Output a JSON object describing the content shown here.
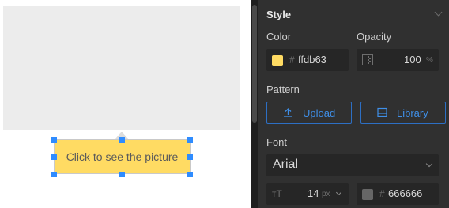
{
  "canvas": {
    "caption_text": "Click to see the picture",
    "caption_color": "#ffdb63",
    "selection_handle_color": "#2f8cff"
  },
  "style_panel": {
    "title": "Style",
    "collapse_icon": "chevron-down-icon",
    "color": {
      "label": "Color",
      "hash": "#",
      "value": "ffdb63"
    },
    "opacity": {
      "label": "Opacity",
      "value": "100",
      "unit": "%",
      "icon": "opacity-icon"
    },
    "pattern": {
      "label": "Pattern",
      "upload_label": "Upload",
      "upload_icon": "upload-icon",
      "library_label": "Library",
      "library_icon": "library-icon"
    },
    "font": {
      "label": "Font",
      "family": "Arial",
      "size_icon": "font-size-icon",
      "size": "14",
      "size_unit": "px",
      "color_hash": "#",
      "color_value": "666666"
    },
    "accent_color": "#3f8fe8",
    "panel_bg": "#303030"
  }
}
